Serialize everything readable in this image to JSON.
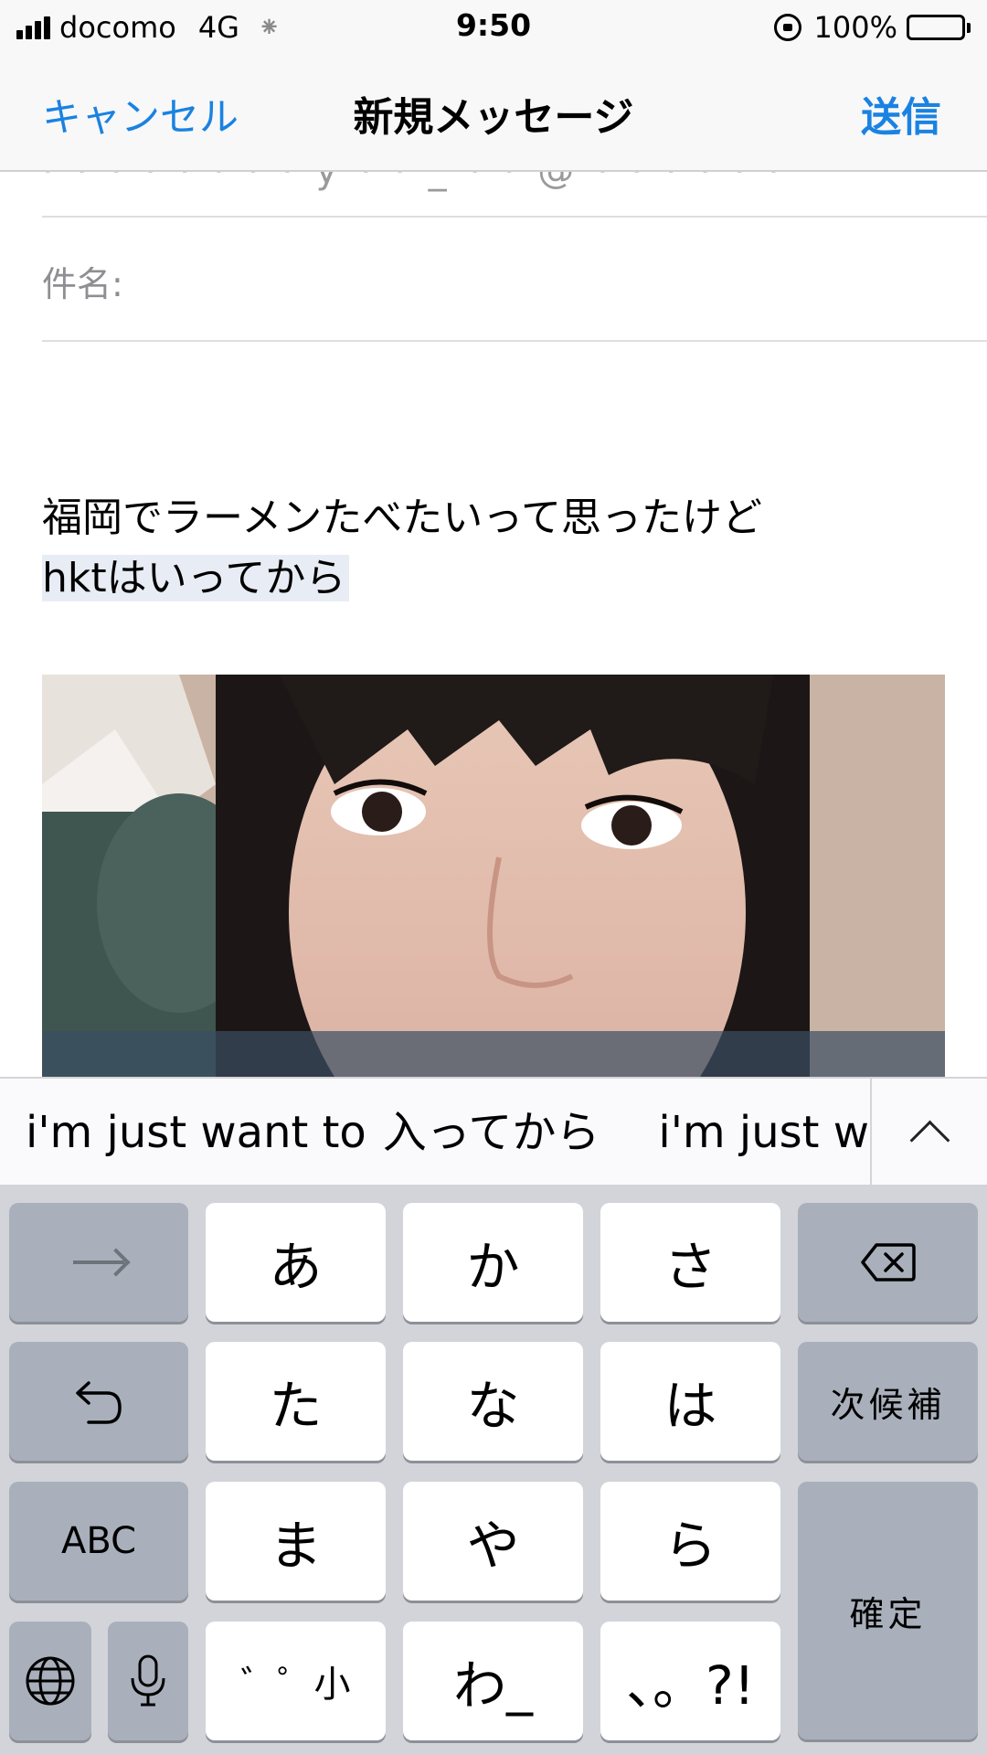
{
  "status_bar": {
    "carrier": "docomo",
    "network": "4G",
    "activity": "⁕",
    "time": "9:50",
    "battery": "100%"
  },
  "nav": {
    "cancel": "キャンセル",
    "title": "新規メッセージ",
    "send": "送信"
  },
  "compose": {
    "recipient_partial": "· · ·  ·  · · · ·  y · · _ · ·  @ · · · · · ·",
    "subject_label": "件名:",
    "body_lines": [
      "福岡でラーメンたべたいって思ったけど",
      "hktはいってから"
    ]
  },
  "predictive": {
    "candidates": [
      "i'm just want to",
      "入ってから",
      "i'm just w"
    ]
  },
  "keyboard": {
    "row1": [
      "あ",
      "か",
      "さ"
    ],
    "row2": [
      "た",
      "な",
      "は"
    ],
    "row3": [
      "ま",
      "や",
      "ら"
    ],
    "row4": [
      "゛゜小",
      "わ_",
      "、。?!"
    ],
    "next_candidate": "次候補",
    "abc": "ABC",
    "confirm": "確定"
  },
  "colors": {
    "accent": "#1a82e2",
    "keyboard_bg": "#d2d4da",
    "dark_key": "#a9b0bb",
    "light_key": "#ffffff",
    "marked_text_bg": "#e8ecf4"
  },
  "icons": {
    "signal": "cellular-signal-icon",
    "lock": "rotation-lock-icon",
    "battery": "battery-icon",
    "arrow": "arrow-right-icon",
    "backspace": "backspace-icon",
    "undo": "undo-icon",
    "globe": "globe-icon",
    "mic": "microphone-icon",
    "expand": "chevron-up-icon"
  }
}
